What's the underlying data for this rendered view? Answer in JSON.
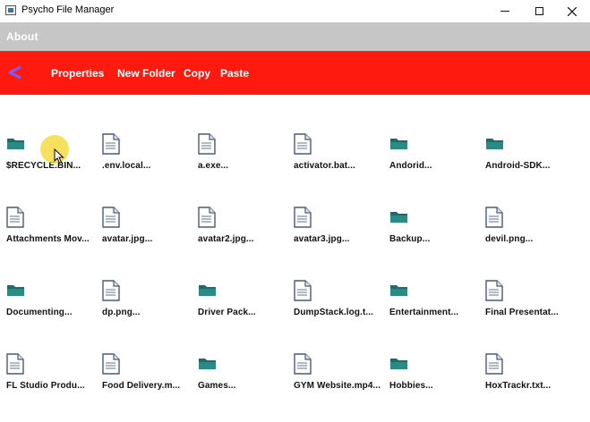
{
  "window": {
    "title": "Psycho File Manager",
    "controls": [
      "minimize",
      "maximize",
      "close"
    ]
  },
  "menu": {
    "items": [
      {
        "label": "About"
      }
    ]
  },
  "toolbar": {
    "back_icon": "chevron-left-icon",
    "buttons": [
      {
        "label": "Properties"
      },
      {
        "label": "New Folder"
      },
      {
        "label": "Copy"
      },
      {
        "label": "Paste"
      }
    ]
  },
  "colors": {
    "menubar_bg": "#c6c6c6",
    "toolbar_bg": "#ff1a0f",
    "back_arrow": "#7b5cff",
    "folder": "#1d6b6b",
    "file_icon": "#4a5a7a",
    "cursor_halo": "#f4d628"
  },
  "files": [
    {
      "name": "$RECYCLE.BIN...",
      "type": "folder"
    },
    {
      "name": ".env.local...",
      "type": "file"
    },
    {
      "name": "a.exe...",
      "type": "file"
    },
    {
      "name": "activator.bat...",
      "type": "file"
    },
    {
      "name": "Andorid...",
      "type": "folder"
    },
    {
      "name": "Android-SDK...",
      "type": "folder"
    },
    {
      "name": "Attachments Mov...",
      "type": "file"
    },
    {
      "name": "avatar.jpg...",
      "type": "file"
    },
    {
      "name": "avatar2.jpg...",
      "type": "file"
    },
    {
      "name": "avatar3.jpg...",
      "type": "file"
    },
    {
      "name": "Backup...",
      "type": "folder"
    },
    {
      "name": "devil.png...",
      "type": "file"
    },
    {
      "name": "Documenting...",
      "type": "folder"
    },
    {
      "name": "dp.png...",
      "type": "file"
    },
    {
      "name": "Driver Pack...",
      "type": "folder"
    },
    {
      "name": "DumpStack.log.t...",
      "type": "file"
    },
    {
      "name": "Entertainment...",
      "type": "folder"
    },
    {
      "name": "Final Presentat...",
      "type": "file"
    },
    {
      "name": "FL Studio Produ...",
      "type": "file"
    },
    {
      "name": "Food Delivery.m...",
      "type": "file"
    },
    {
      "name": "Games...",
      "type": "folder"
    },
    {
      "name": "GYM Website.mp4...",
      "type": "file"
    },
    {
      "name": "Hobbies...",
      "type": "folder"
    },
    {
      "name": "HoxTrackr.txt...",
      "type": "file"
    }
  ]
}
